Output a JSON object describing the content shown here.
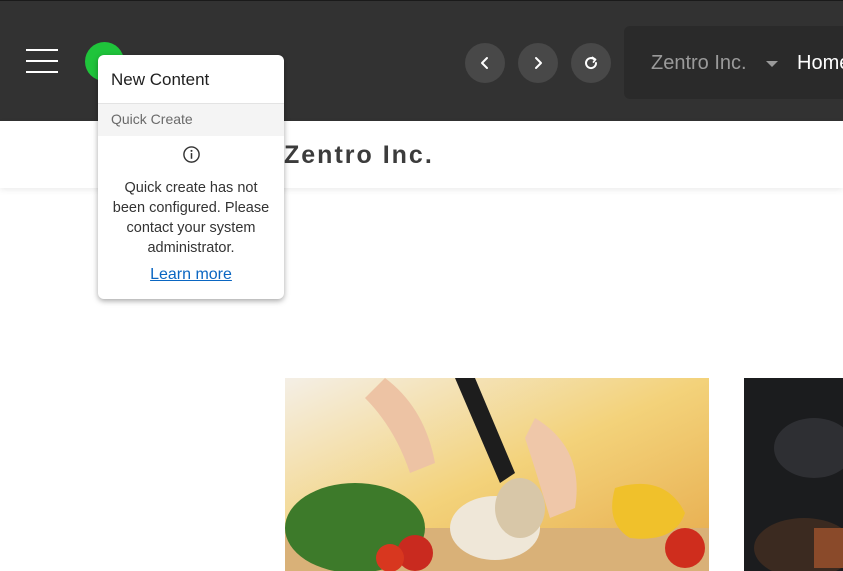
{
  "header": {
    "site_selector": {
      "value": "Zentro Inc."
    },
    "home_label": "Home"
  },
  "page": {
    "title": "Zentro Inc."
  },
  "popup": {
    "title": "New Content",
    "section_label": "Quick Create",
    "message": "Quick create has not been configured. Please contact your system administrator.",
    "link_label": "Learn more"
  },
  "colors": {
    "topbar": "#323232",
    "status_dot": "#1fc43b",
    "link": "#0a66c2"
  },
  "icons": [
    "hamburger-menu-icon",
    "chevron-left-icon",
    "chevron-right-icon",
    "refresh-icon",
    "caret-down-icon",
    "info-icon"
  ]
}
